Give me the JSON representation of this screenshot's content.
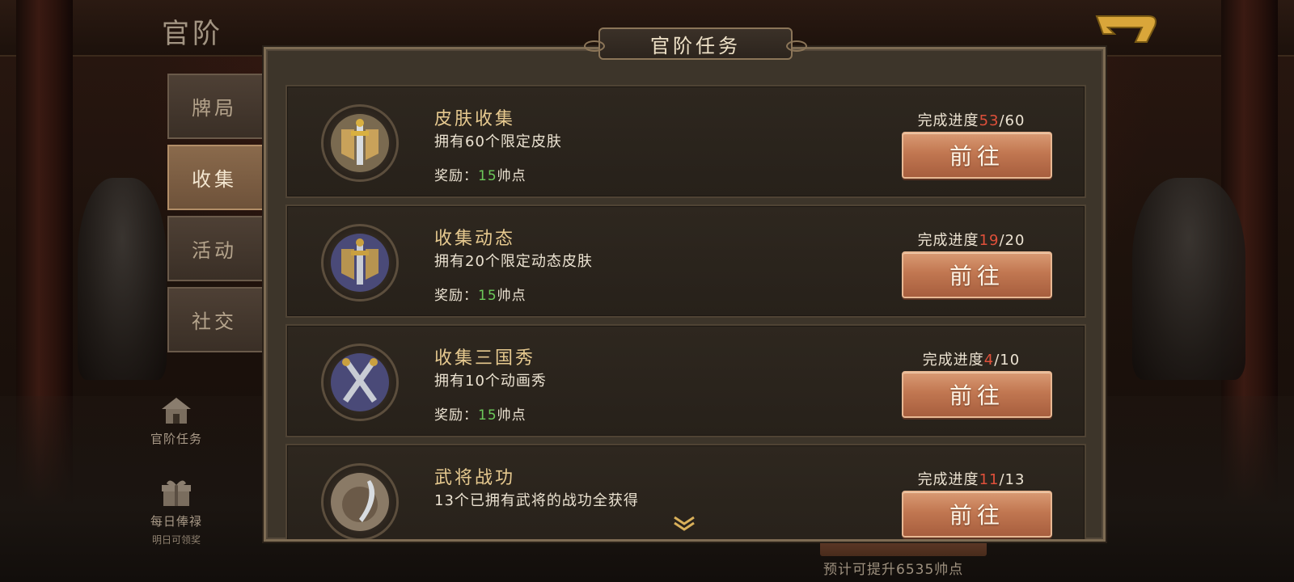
{
  "page_title": "官阶",
  "panel": {
    "title": "官阶任务",
    "scroll_more_icon": "double-chevron-down-icon"
  },
  "side_tabs": [
    {
      "label": "牌局",
      "active": false
    },
    {
      "label": "收集",
      "active": true
    },
    {
      "label": "活动",
      "active": false
    },
    {
      "label": "社交",
      "active": false
    }
  ],
  "side_menu": {
    "rank_tasks": {
      "label": "官阶任务",
      "icon": "building-icon"
    },
    "daily_salary": {
      "label": "每日俸禄",
      "sub": "明日可领奖",
      "icon": "gift-box-icon"
    }
  },
  "tasks": [
    {
      "title": "皮肤收集",
      "desc": "拥有60个限定皮肤",
      "reward_label": "奖励：",
      "reward_value": "15",
      "reward_unit": "帅点",
      "progress_label": "完成进度",
      "progress_current": "53",
      "progress_total": "/60",
      "button": "前往",
      "icon": "golden-sword-medal-icon"
    },
    {
      "title": "收集动态",
      "desc": "拥有20个限定动态皮肤",
      "reward_label": "奖励：",
      "reward_value": "15",
      "reward_unit": "帅点",
      "progress_label": "完成进度",
      "progress_current": "19",
      "progress_total": "/20",
      "button": "前往",
      "icon": "blue-sword-medal-icon"
    },
    {
      "title": "收集三国秀",
      "desc": "拥有10个动画秀",
      "reward_label": "奖励：",
      "reward_value": "15",
      "reward_unit": "帅点",
      "progress_label": "完成进度",
      "progress_current": "4",
      "progress_total": "/10",
      "button": "前往",
      "icon": "crossed-swords-medal-icon"
    },
    {
      "title": "武将战功",
      "desc": "13个已拥有武将的战功全获得",
      "reward_label": "",
      "reward_value": "",
      "reward_unit": "",
      "progress_label": "完成进度",
      "progress_current": "11",
      "progress_total": "/13",
      "button": "前往",
      "icon": "shield-blade-medal-icon"
    }
  ],
  "bottom_hint": "预计可提升6535帅点",
  "colors": {
    "progress_current": "#e0503a",
    "reward_value": "#6cc95a",
    "task_title": "#e6c98f",
    "button": "#c17751"
  }
}
